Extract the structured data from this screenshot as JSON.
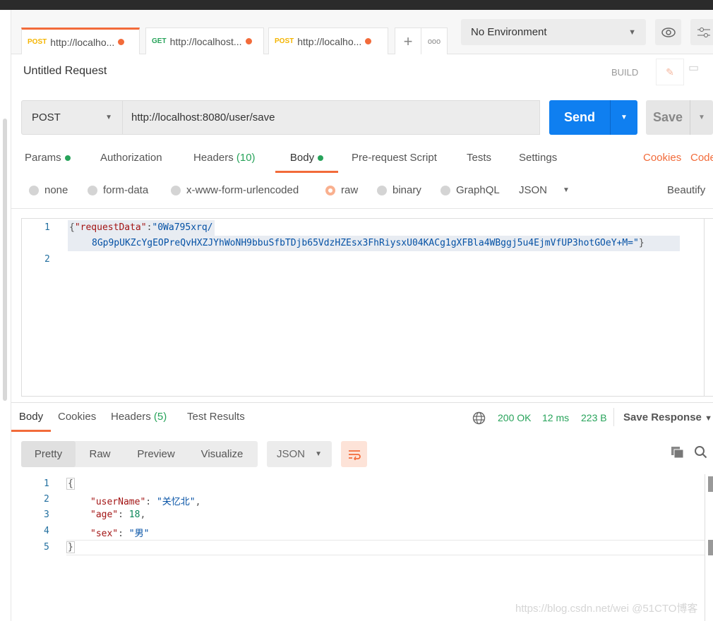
{
  "tabs": [
    {
      "method": "POST",
      "url": "http://localho..."
    },
    {
      "method": "GET",
      "url": "http://localhost..."
    },
    {
      "method": "POST",
      "url": "http://localho..."
    }
  ],
  "environment": "No Environment",
  "request": {
    "title": "Untitled Request",
    "build": "BUILD",
    "method": "POST",
    "url": "http://localhost:8080/user/save",
    "send": "Send",
    "save": "Save"
  },
  "req_tabs": {
    "params": "Params",
    "authorization": "Authorization",
    "headers": "Headers",
    "headers_count": "(10)",
    "body": "Body",
    "prerequest": "Pre-request Script",
    "tests": "Tests",
    "settings": "Settings",
    "cookies": "Cookies",
    "code": "Code"
  },
  "body_types": {
    "none": "none",
    "form_data": "form-data",
    "urlencoded": "x-www-form-urlencoded",
    "raw": "raw",
    "binary": "binary",
    "graphql": "GraphQL",
    "format": "JSON",
    "beautify": "Beautify",
    "selected": "raw"
  },
  "request_body": {
    "line1_open": "{",
    "key": "\"requestData\"",
    "colon": ":",
    "value_part1": "\"0Wa795xrq/",
    "value_part2": "8Gp9pUKZcYgEOPreQvHXZJYhWoNH9bbuSfbTDjb65VdzHZEsx3FhRiysxU04KACg1gXFBla4WBggj5u4EjmVfUP3hotGOeY+M=\"",
    "close": "}",
    "line_numbers": [
      "1",
      "2"
    ]
  },
  "response": {
    "tabs": {
      "body": "Body",
      "cookies": "Cookies",
      "headers": "Headers",
      "headers_count": "(5)",
      "test_results": "Test Results"
    },
    "status": "200 OK",
    "time": "12 ms",
    "size": "223 B",
    "save_response": "Save Response",
    "views": {
      "pretty": "Pretty",
      "raw": "Raw",
      "preview": "Preview",
      "visualize": "Visualize"
    },
    "format": "JSON",
    "lines": {
      "numbers": [
        "1",
        "2",
        "3",
        "4",
        "5"
      ],
      "open": "{",
      "k1": "\"userName\"",
      "v1": "\"关忆北\"",
      "k2": "\"age\"",
      "v2": "18",
      "k3": "\"sex\"",
      "v3": "\"男\"",
      "close": "}"
    }
  },
  "watermark": "https://blog.csdn.net/wei @51CTO博客",
  "colors": {
    "accent": "#f26b3a",
    "send": "#0f7ff0",
    "success": "#27a35a"
  }
}
